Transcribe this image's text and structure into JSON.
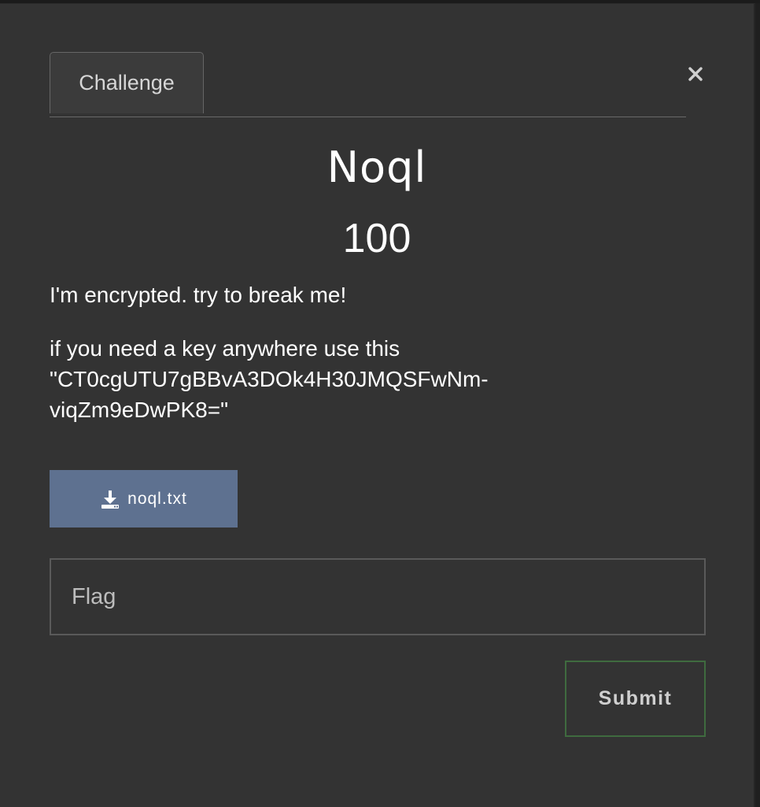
{
  "tabs": [
    {
      "label": "Challenge"
    }
  ],
  "close": {
    "icon": "close-icon",
    "glyph": "×"
  },
  "challenge": {
    "name": "Noql",
    "points": "100",
    "description": [
      "I'm encrypted. try to break me!",
      "if you need a key anywhere use this \"CT0cgUTU7gBBvA3DOk4H30JMQSFwNm-viqZm9eDwPK8=\""
    ]
  },
  "download": {
    "icon": "download-icon",
    "filename": "noql.txt"
  },
  "flag_input": {
    "value": "",
    "placeholder": "Flag"
  },
  "submit": {
    "label": "Submit"
  },
  "colors": {
    "modal_bg": "#333333",
    "download_bg": "#5e7190",
    "submit_border": "#3f6b3f"
  }
}
